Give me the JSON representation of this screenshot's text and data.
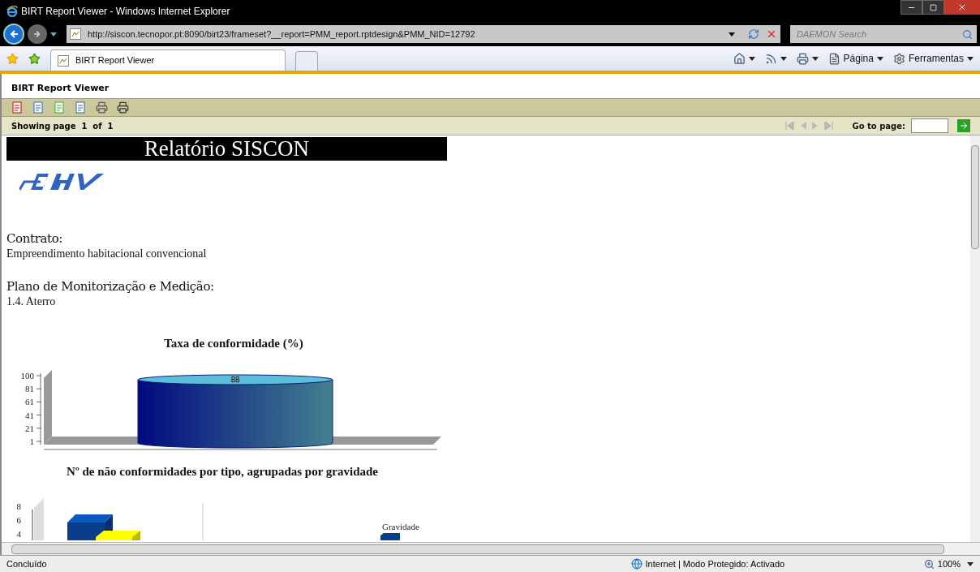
{
  "window": {
    "title": "BIRT Report Viewer - Windows Internet Explorer"
  },
  "address_bar": {
    "url": "http://siscon.tecnopor.pt:8090/birt23/frameset?__report=PMM_report.rptdesign&PMM_NID=12792",
    "search_placeholder": "DAEMON Search"
  },
  "tabs": [
    {
      "label": "BIRT Report Viewer",
      "selected": true
    }
  ],
  "command_bar": [
    {
      "kind": "home"
    },
    {
      "kind": "feed"
    },
    {
      "kind": "print"
    },
    {
      "kind": "page",
      "label": "Página"
    },
    {
      "kind": "tools",
      "label": "Ferramentas"
    }
  ],
  "viewer": {
    "title": "BIRT Report Viewer",
    "page_info": "Showing page  1  of  1",
    "goto_label": "Go to page:"
  },
  "report": {
    "title": "Relatório SISCON",
    "sections": [
      {
        "label": "Contrato:",
        "value": "Empreendimento habitacional convencional"
      },
      {
        "label": "Plano de Monitorização e Medição:",
        "value": "1.4. Aterro"
      }
    ],
    "chart1": {
      "title": "Taxa de conformidade (%)",
      "y_labels": [
        "100",
        "81",
        "61",
        "41",
        "21",
        "1"
      ],
      "value_label": "88"
    },
    "chart2": {
      "title": "Nº de não conformidades por tipo, agrupadas por gravidade",
      "y_labels": [
        "8",
        "6",
        "4"
      ],
      "legend_title": "Gravidade"
    }
  },
  "status_bar": {
    "text": "Concluído",
    "zone": "Internet | Modo Protegido: Activado",
    "zoom": "100%"
  }
}
